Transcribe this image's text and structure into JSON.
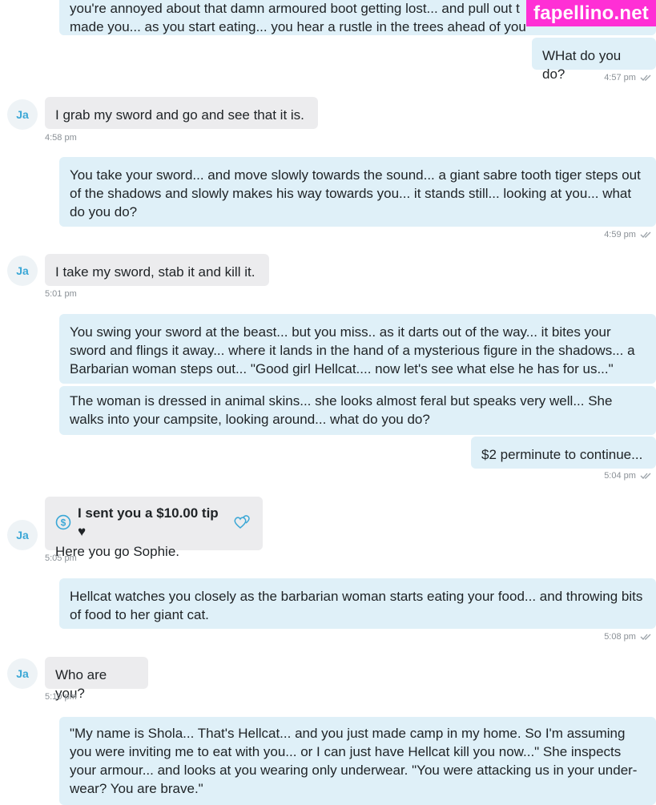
{
  "watermark": "fapellino.net",
  "contact_initials": "Ja",
  "colors": {
    "outgoing_bubble": "#dff0f8",
    "incoming_bubble": "#ececee",
    "accent": "#3aa7d6",
    "watermark_bg": "#ff2fd5"
  },
  "messages": [
    {
      "dir": "out",
      "text": "you're annoyed about that damn armoured boot getting lost... and pull out t\nmade you... as you start eating... you hear a rustle in the trees ahead of you"
    },
    {
      "dir": "out",
      "text": "WHat do you do?",
      "time": "4:57 pm"
    },
    {
      "dir": "in",
      "text": "I grab my sword and go and see that it is.",
      "time": "4:58 pm"
    },
    {
      "dir": "out",
      "text": "You take your sword... and move slowly towards the sound... a giant sabre tooth tiger steps out of the shadows and slowly makes his way towards you... it stands still... looking at you... what do you do?",
      "time": "4:59 pm"
    },
    {
      "dir": "in",
      "text": "I take my sword, stab it and kill it.",
      "time": "5:01 pm"
    },
    {
      "dir": "out",
      "text": "You swing your sword at the beast... but you miss.. as it darts out of the way... it bites your sword and flings it away... where it lands in the hand of a mysterious figure in the shadows... a Barbarian woman steps out... \"Good girl Hellcat.... now let's see what else he has for us...\""
    },
    {
      "dir": "out",
      "text": "The woman is dressed in animal skins... she looks almost feral but speaks very well... She walks into your campsite, looking around... what do you do?"
    },
    {
      "dir": "out",
      "text": "$2 perminute to continue...",
      "time": "5:04 pm"
    },
    {
      "dir": "in",
      "tip": "I sent you a $10.00 tip ♥",
      "text": "Here you go Sophie.",
      "time": "5:05 pm"
    },
    {
      "dir": "out",
      "text": "Hellcat watches you closely as the barbarian woman starts eating your food... and throwing bits of food to her giant cat.",
      "time": "5:08 pm"
    },
    {
      "dir": "in",
      "text": "Who are you?",
      "time": "5:10 pm"
    },
    {
      "dir": "out",
      "text": "\"My name is Shola... That's Hellcat... and you just made camp in my home. So I'm assuming you were inviting me to eat with you... or I can just have Hellcat kill you now...\" She inspects your armour... and looks at you wearing only underwear. \"You were attacking us in your under-wear? You are brave.\""
    }
  ]
}
